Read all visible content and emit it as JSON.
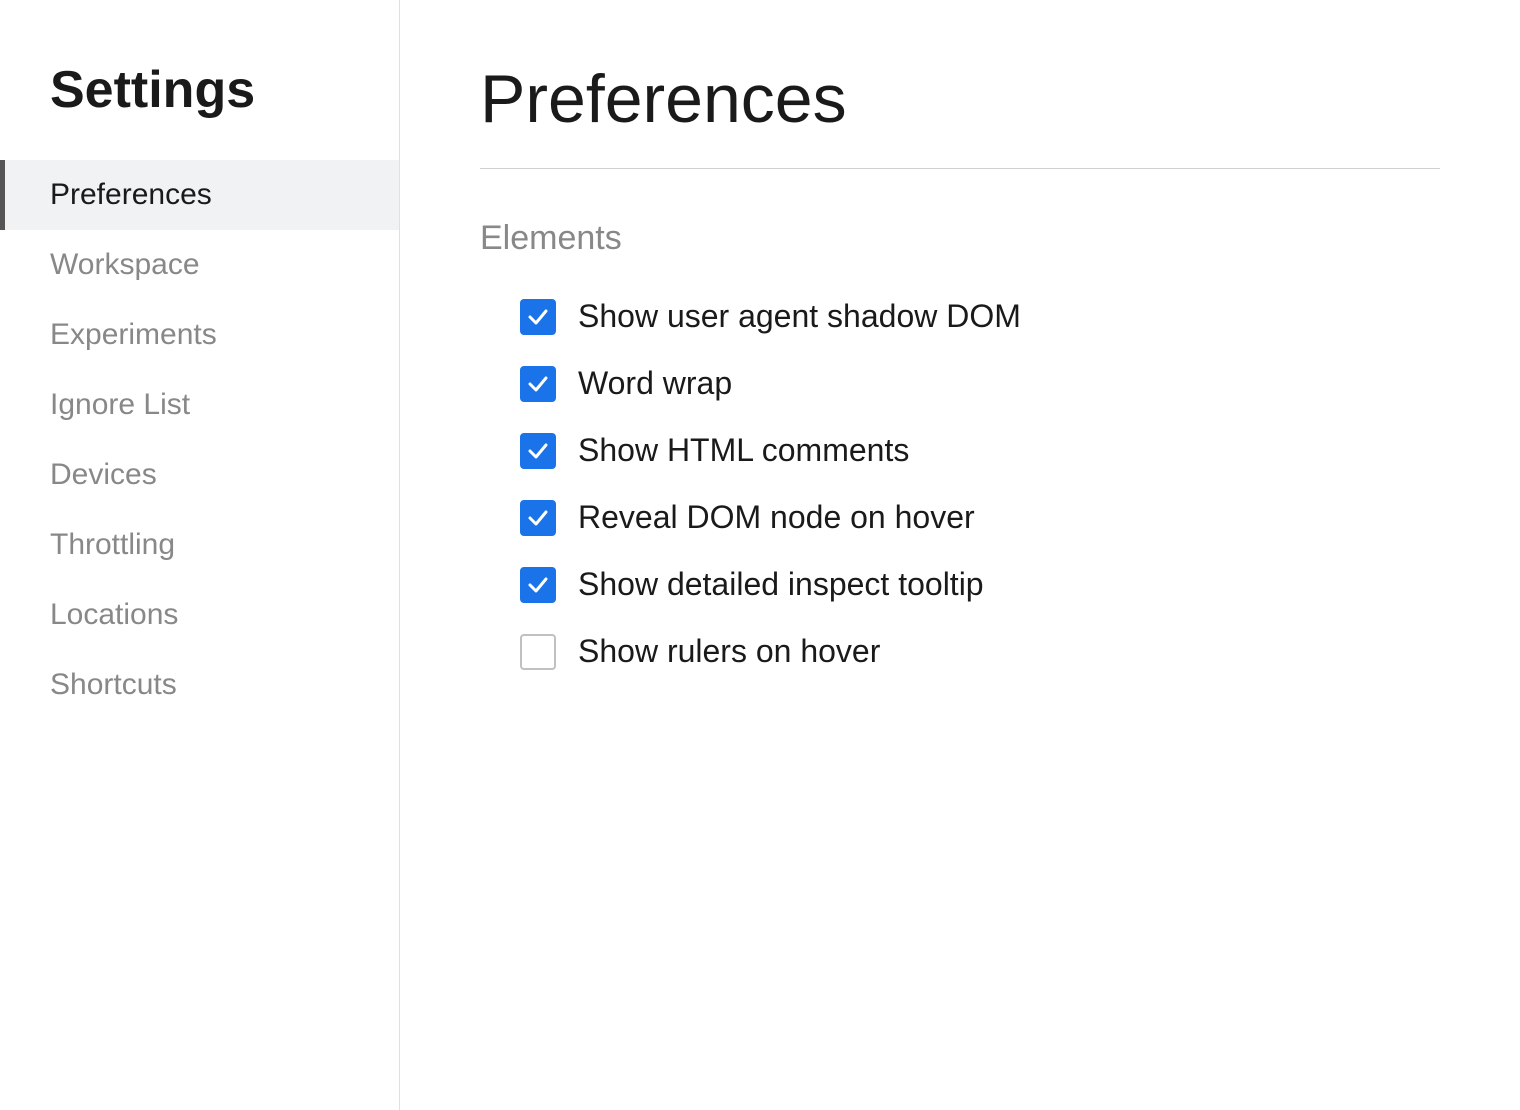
{
  "sidebar": {
    "title": "Settings",
    "items": [
      {
        "id": "preferences",
        "label": "Preferences",
        "active": true
      },
      {
        "id": "workspace",
        "label": "Workspace",
        "active": false
      },
      {
        "id": "experiments",
        "label": "Experiments",
        "active": false
      },
      {
        "id": "ignore-list",
        "label": "Ignore List",
        "active": false
      },
      {
        "id": "devices",
        "label": "Devices",
        "active": false
      },
      {
        "id": "throttling",
        "label": "Throttling",
        "active": false
      },
      {
        "id": "locations",
        "label": "Locations",
        "active": false
      },
      {
        "id": "shortcuts",
        "label": "Shortcuts",
        "active": false
      }
    ]
  },
  "main": {
    "page_title": "Preferences",
    "sections": [
      {
        "id": "elements",
        "title": "Elements",
        "checkboxes": [
          {
            "id": "shadow-dom",
            "label": "Show user agent shadow DOM",
            "checked": true
          },
          {
            "id": "word-wrap",
            "label": "Word wrap",
            "checked": true
          },
          {
            "id": "html-comments",
            "label": "Show HTML comments",
            "checked": true
          },
          {
            "id": "reveal-dom",
            "label": "Reveal DOM node on hover",
            "checked": true
          },
          {
            "id": "inspect-tooltip",
            "label": "Show detailed inspect tooltip",
            "checked": true
          },
          {
            "id": "rulers-hover",
            "label": "Show rulers on hover",
            "checked": false
          }
        ]
      }
    ]
  },
  "colors": {
    "checkbox_checked": "#1a73e8",
    "sidebar_active_bar": "#555555",
    "sidebar_active_bg": "#f0f2f4"
  }
}
